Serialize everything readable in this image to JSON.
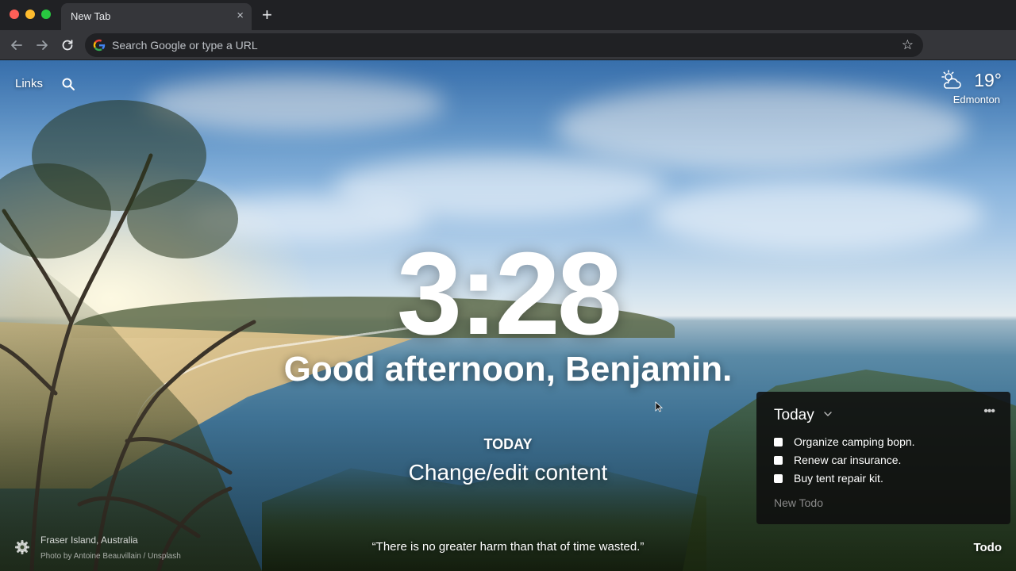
{
  "browser": {
    "tab_title": "New Tab",
    "tab_close_glyph": "×",
    "new_tab_glyph": "+",
    "omnibox_placeholder": "Search Google or type a URL",
    "icons": [
      "back-arrow-icon",
      "forward-arrow-icon",
      "reload-icon",
      "google-icon",
      "star-icon",
      "extension-icon",
      "profile-avatar",
      "kebab-menu-icon"
    ]
  },
  "links": {
    "label": "Links"
  },
  "weather": {
    "temperature": "19°",
    "location": "Edmonton",
    "icon": "partly-cloudy-icon"
  },
  "clock": {
    "time": "3:28"
  },
  "greeting": {
    "text": "Good afternoon, Benjamin."
  },
  "focus": {
    "label": "TODAY",
    "text": "Change/edit content"
  },
  "photo": {
    "location": "Fraser Island, Australia",
    "credit": "Photo by Antoine Beauvillain / Unsplash"
  },
  "quote": {
    "text": "“There is no greater harm than that of time wasted.”"
  },
  "todo": {
    "toggle_label": "Todo",
    "list_title": "Today",
    "more_glyph": "•••",
    "items": [
      {
        "text": "Organize camping bopn.",
        "done": false
      },
      {
        "text": "Renew car insurance.",
        "done": false
      },
      {
        "text": "Buy tent repair kit.",
        "done": false
      }
    ],
    "new_placeholder": "New Todo"
  },
  "colors": {
    "chrome_dark": "#202124",
    "chrome_toolbar": "#35363a",
    "panel_bg": "#0f0f0f",
    "text": "#ffffff"
  }
}
